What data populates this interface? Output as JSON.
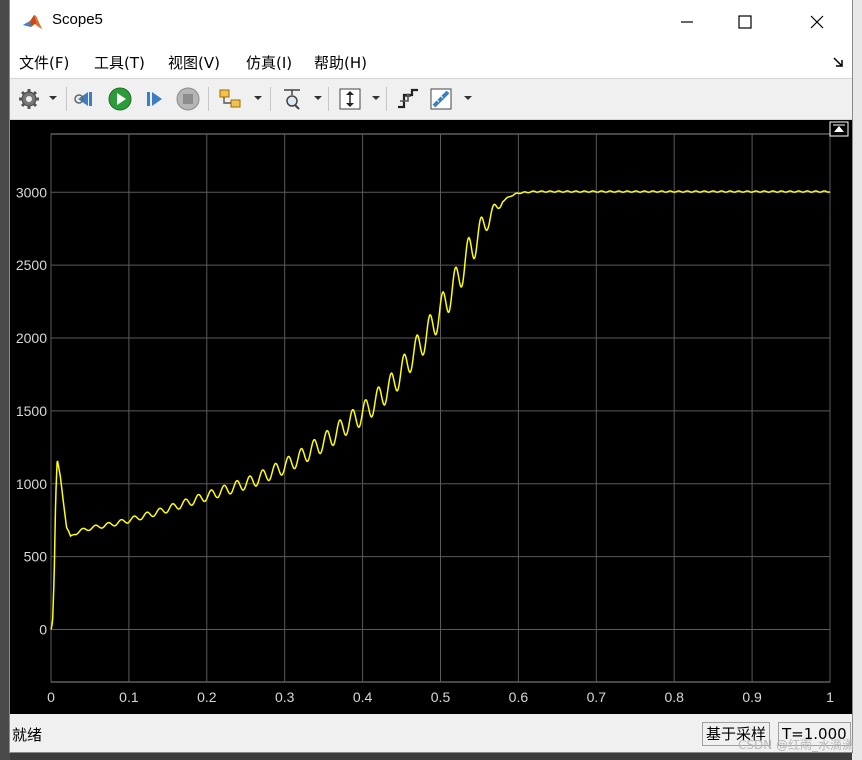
{
  "window": {
    "title": "Scope5"
  },
  "menu": [
    "文件(F)",
    "工具(T)",
    "视图(V)",
    "仿真(I)",
    "帮助(H)"
  ],
  "status": {
    "text": "就绪",
    "sampling": "基于采样",
    "time": "T=1.000"
  },
  "watermark": "CSDN @红雨_水滴潇",
  "colors": {
    "trace": "#ffff00",
    "grid": "#5a5a5a",
    "plot_bg": "#000000",
    "axis_text": "#ffffff"
  },
  "toolbar_icons": [
    "gear-icon",
    "step-back-icon",
    "run-icon",
    "step-forward-icon",
    "stop-icon",
    "highlight-block-icon",
    "zoom-icon",
    "autoscale-icon",
    "triggers-icon",
    "measurements-icon"
  ],
  "chart_data": {
    "type": "line",
    "xlim": [
      0,
      1
    ],
    "ylim": [
      -360,
      3400
    ],
    "xticks": [
      "0",
      "0.1",
      "0.2",
      "0.3",
      "0.4",
      "0.5",
      "0.6",
      "0.7",
      "0.8",
      "0.9",
      "1"
    ],
    "yticks": [
      "0",
      "500",
      "1000",
      "1500",
      "2000",
      "2500",
      "3000"
    ],
    "grid": true,
    "series": [
      {
        "x": [
          0,
          0.002,
          0.004,
          0.006,
          0.008,
          0.012,
          0.016,
          0.02,
          0.025,
          0.03,
          0.035,
          0.04,
          0.05,
          0.06,
          0.07,
          0.08,
          0.1,
          0.12,
          0.14,
          0.16,
          0.18,
          0.2,
          0.22,
          0.24,
          0.26,
          0.28,
          0.3,
          0.32,
          0.34,
          0.36,
          0.38,
          0.4,
          0.42,
          0.44,
          0.46,
          0.48,
          0.5,
          0.52,
          0.54,
          0.55,
          0.56,
          0.57,
          0.58,
          0.59,
          0.6,
          0.62,
          0.65,
          0.7,
          0.75,
          0.8,
          0.85,
          0.9,
          0.95,
          1.0
        ],
        "y": [
          0,
          50,
          350,
          900,
          1170,
          1050,
          870,
          700,
          630,
          660,
          670,
          680,
          695,
          705,
          715,
          725,
          750,
          780,
          810,
          845,
          880,
          915,
          950,
          985,
          1020,
          1070,
          1120,
          1180,
          1250,
          1320,
          1410,
          1480,
          1580,
          1690,
          1850,
          2000,
          2180,
          2380,
          2620,
          2720,
          2810,
          2880,
          2940,
          2975,
          2995,
          3005,
          3005,
          3005,
          3005,
          3005,
          3005,
          3005,
          3005,
          3005
        ],
        "ripple_from": 0.02,
        "ripple_to": 0.58,
        "ripple_period": 0.0165
      }
    ]
  }
}
